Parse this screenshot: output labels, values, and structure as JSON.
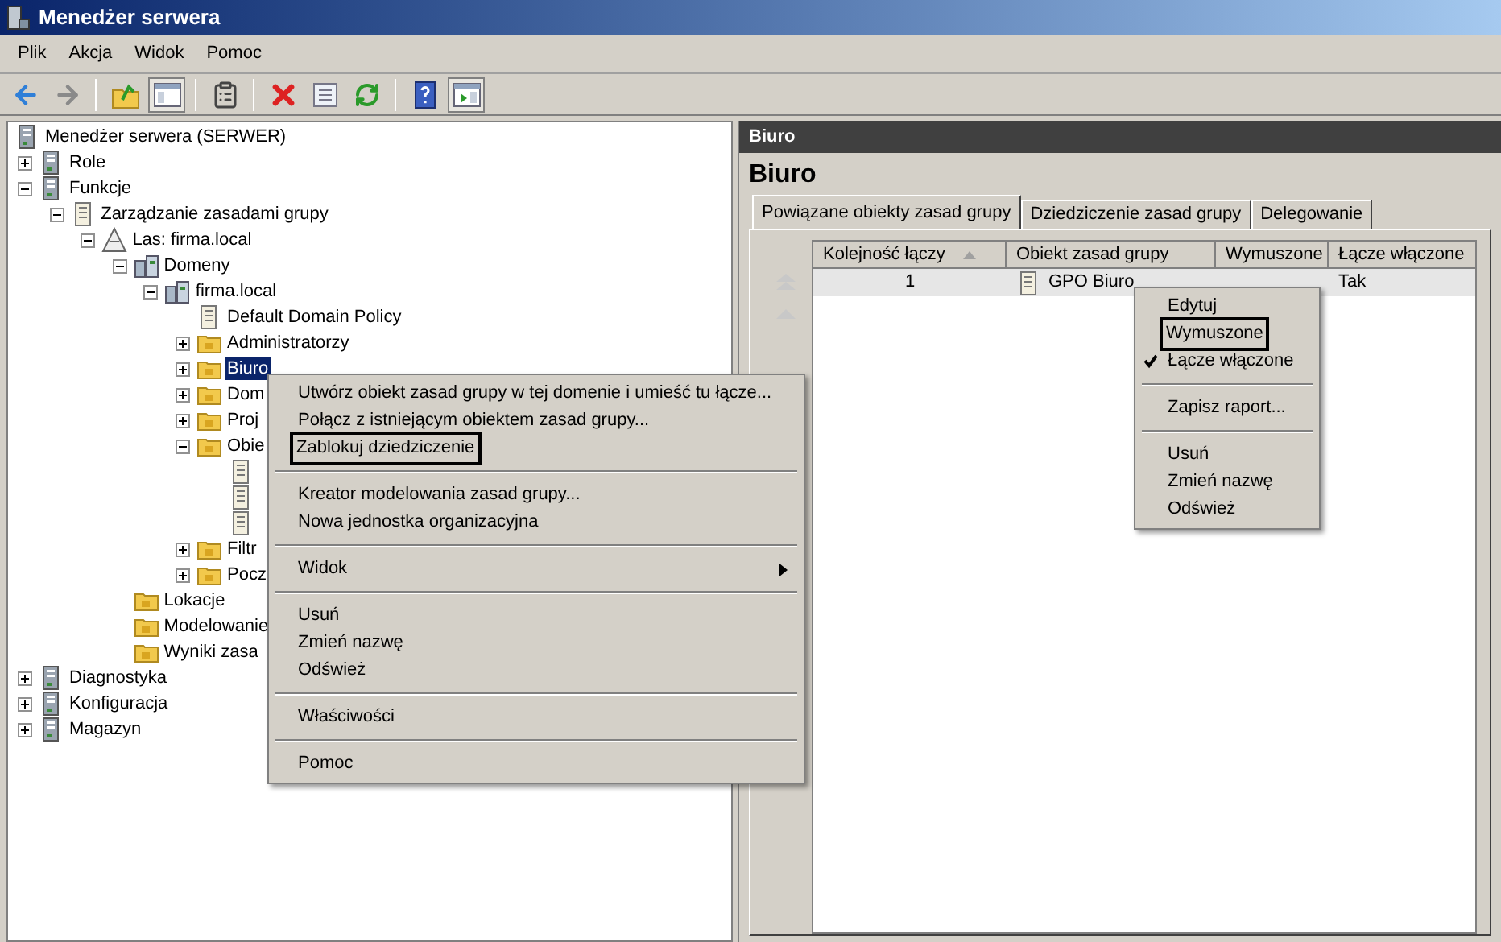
{
  "window": {
    "title": "Menedżer serwera"
  },
  "menu_bar": [
    "Plik",
    "Akcja",
    "Widok",
    "Pomoc"
  ],
  "toolbar": [
    {
      "kind": "back",
      "pressed": false
    },
    {
      "kind": "forward",
      "pressed": false
    },
    {
      "kind": "sep"
    },
    {
      "kind": "up",
      "pressed": false
    },
    {
      "kind": "tree",
      "pressed": true
    },
    {
      "kind": "sep"
    },
    {
      "kind": "properties",
      "pressed": false
    },
    {
      "kind": "sep"
    },
    {
      "kind": "delete",
      "pressed": false
    },
    {
      "kind": "export",
      "pressed": false
    },
    {
      "kind": "refresh",
      "pressed": false
    },
    {
      "kind": "sep"
    },
    {
      "kind": "help",
      "pressed": false
    },
    {
      "kind": "actions",
      "pressed": true
    }
  ],
  "tree": [
    {
      "label": "Menedżer serwera (SERWER)",
      "kind": "server",
      "selected": false,
      "children": [
        {
          "label": "Role",
          "kind": "server",
          "expanded": false,
          "selected": false
        },
        {
          "label": "Funkcje",
          "kind": "server",
          "expanded": true,
          "selected": false,
          "children": [
            {
              "label": "Zarządzanie zasadami grupy",
              "kind": "document",
              "expanded": true,
              "selected": false,
              "children": [
                {
                  "label": "Las: firma.local",
                  "kind": "triangle",
                  "expanded": true,
                  "selected": false,
                  "children": [
                    {
                      "label": "Domeny",
                      "kind": "buildings",
                      "expanded": true,
                      "selected": false,
                      "children": [
                        {
                          "label": "firma.local",
                          "kind": "buildings",
                          "expanded": true,
                          "selected": false,
                          "children": [
                            {
                              "label": "Default Domain Policy",
                              "kind": "document",
                              "selected": false
                            },
                            {
                              "label": "Administratorzy",
                              "kind": "folder",
                              "expanded": false,
                              "selected": false
                            },
                            {
                              "label": "Biuro",
                              "kind": "folder",
                              "expanded": false,
                              "selected": true
                            },
                            {
                              "label": "Dom",
                              "kind": "folder",
                              "expanded": false,
                              "selected": false
                            },
                            {
                              "label": "Proj",
                              "kind": "folder",
                              "expanded": false,
                              "selected": false
                            },
                            {
                              "label": "Obie",
                              "kind": "folder",
                              "expanded": true,
                              "selected": false,
                              "children": [
                                {
                                  "kind": "document"
                                },
                                {
                                  "kind": "document"
                                },
                                {
                                  "kind": "document"
                                }
                              ]
                            },
                            {
                              "label": "Filtr",
                              "kind": "folder",
                              "expanded": false,
                              "selected": false
                            },
                            {
                              "label": "Pocz",
                              "kind": "folder",
                              "expanded": false,
                              "selected": false
                            }
                          ]
                        }
                      ]
                    },
                    {
                      "label": "Lokacje",
                      "kind": "folder",
                      "selected": false
                    },
                    {
                      "label": "Modelowanie",
                      "kind": "folder",
                      "selected": false
                    },
                    {
                      "label": "Wyniki zasa",
                      "kind": "folder",
                      "selected": false
                    }
                  ]
                }
              ]
            }
          ]
        },
        {
          "label": "Diagnostyka",
          "kind": "server",
          "expanded": false,
          "selected": false
        },
        {
          "label": "Konfiguracja",
          "kind": "server",
          "expanded": false,
          "selected": false
        },
        {
          "label": "Magazyn",
          "kind": "server",
          "expanded": false,
          "selected": false
        }
      ]
    }
  ],
  "details": {
    "header": "Biuro",
    "title": "Biuro",
    "tabs": [
      {
        "label": "Powiązane obiekty zasad grupy",
        "selected": true
      },
      {
        "label": "Dziedziczenie zasad grupy",
        "selected": false
      },
      {
        "label": "Delegowanie",
        "selected": false
      }
    ],
    "table": {
      "columns": [
        {
          "label": "Kolejność łączy",
          "sorted": true
        },
        {
          "label": "Obiekt zasad grupy",
          "sorted": false
        },
        {
          "label": "Wymuszone",
          "sorted": false
        },
        {
          "label": "Łącze włączone",
          "sorted": false
        }
      ],
      "rows": [
        {
          "selected": true,
          "cells": [
            "1",
            "GPO Biuro",
            "",
            "Tak"
          ]
        }
      ]
    }
  },
  "context_menu": [
    {
      "kind": "item",
      "label": "Utwórz obiekt zasad grupy w tej domenie i umieść tu łącze...",
      "highlighted": false
    },
    {
      "kind": "item",
      "label": "Połącz z istniejącym obiektem zasad grupy...",
      "highlighted": false
    },
    {
      "kind": "item",
      "label": "Zablokuj dziedziczenie",
      "highlighted": true
    },
    {
      "kind": "separator"
    },
    {
      "kind": "item",
      "label": "Kreator modelowania zasad grupy...",
      "highlighted": false
    },
    {
      "kind": "item",
      "label": "Nowa jednostka organizacyjna",
      "highlighted": false
    },
    {
      "kind": "separator"
    },
    {
      "kind": "submenu",
      "label": "Widok",
      "highlighted": false
    },
    {
      "kind": "separator"
    },
    {
      "kind": "item",
      "label": "Usuń",
      "highlighted": false
    },
    {
      "kind": "item",
      "label": "Zmień nazwę",
      "highlighted": false
    },
    {
      "kind": "item",
      "label": "Odśwież",
      "highlighted": false
    },
    {
      "kind": "separator"
    },
    {
      "kind": "item",
      "label": "Właściwości",
      "highlighted": false
    },
    {
      "kind": "separator"
    },
    {
      "kind": "item",
      "label": "Pomoc",
      "highlighted": false
    }
  ],
  "link_menu": [
    {
      "kind": "item",
      "label": "Edytuj",
      "highlighted": false,
      "checked": false
    },
    {
      "kind": "item",
      "label": "Wymuszone",
      "highlighted": true,
      "checked": false
    },
    {
      "kind": "item",
      "label": "Łącze włączone",
      "highlighted": false,
      "checked": true
    },
    {
      "kind": "separator"
    },
    {
      "kind": "item",
      "label": "Zapisz raport...",
      "highlighted": false,
      "checked": false
    },
    {
      "kind": "separator"
    },
    {
      "kind": "item",
      "label": "Usuń",
      "highlighted": false,
      "checked": false
    },
    {
      "kind": "item",
      "label": "Zmień nazwę",
      "highlighted": false,
      "checked": false
    },
    {
      "kind": "item",
      "label": "Odśwież",
      "highlighted": false,
      "checked": false
    }
  ]
}
